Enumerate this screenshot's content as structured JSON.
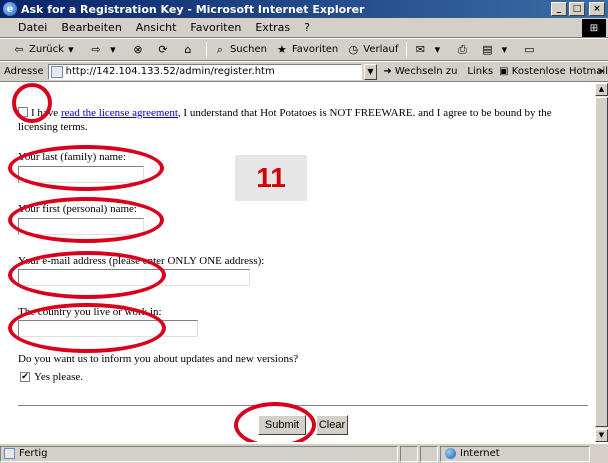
{
  "window": {
    "title": "Ask for a Registration Key - Microsoft Internet Explorer",
    "minimize": "_",
    "maximize": "□",
    "close": "×"
  },
  "menu": [
    "Datei",
    "Bearbeiten",
    "Ansicht",
    "Favoriten",
    "Extras",
    "?"
  ],
  "toolbar": {
    "back": "Zurück",
    "forward": "",
    "search": "Suchen",
    "favorites": "Favoriten",
    "history": "Verlauf"
  },
  "address": {
    "label": "Adresse",
    "url": "http://142.104.133.52/admin/register.htm",
    "go": "Wechseln zu",
    "links": "Links",
    "hotmail": "Kostenlose Hotmail"
  },
  "form": {
    "license_prefix": "I have ",
    "license_link": "read the license agreement",
    "license_suffix": ", I understand that Hot Potatoes is NOT FREEWARE. and I agree to be bound by the licensing terms.",
    "last_name_label": "Your last (family) name:",
    "first_name_label": "Your first (personal) name:",
    "email_label": "Your e-mail address (please enter ONLY ONE address):",
    "country_label": "The country you live or work in:",
    "inform_label": "Do you want us to inform you about updates and new versions?",
    "yes_label": "Yes please.",
    "yes_checked": "✔",
    "submit": "Submit",
    "clear": "Clear"
  },
  "annotation": {
    "step_number": "11",
    "highlight_color": "#d8001a"
  },
  "status": {
    "text": "Fertig",
    "zone": "Internet"
  }
}
